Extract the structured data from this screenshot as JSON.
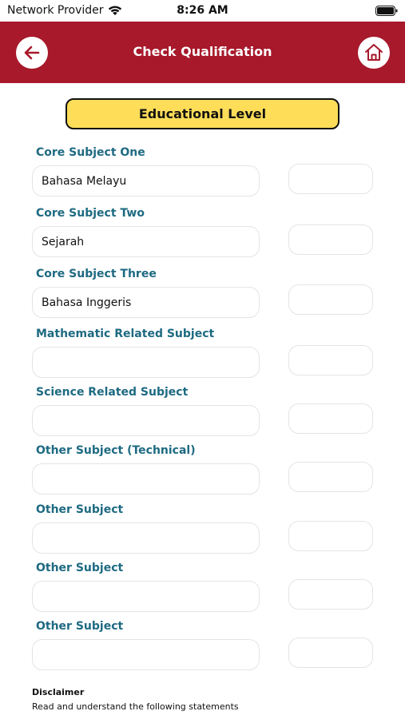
{
  "status_bar": {
    "carrier": "Network Provider",
    "time": "8:26 AM",
    "wifi_icon": "wifi-icon",
    "battery_icon": "battery-icon"
  },
  "header": {
    "title": "Check Qualification",
    "back_icon": "arrow-left-icon",
    "home_icon": "home-icon",
    "background": "#a7192b"
  },
  "educational_level": {
    "label": "Educational Level",
    "background": "#fedd59"
  },
  "fields": [
    {
      "label": "Core Subject One",
      "value": "Bahasa Melayu"
    },
    {
      "label": "Core Subject Two",
      "value": "Sejarah"
    },
    {
      "label": "Core Subject Three",
      "value": "Bahasa Inggeris"
    },
    {
      "label": "Mathematic Related Subject",
      "value": ""
    },
    {
      "label": "Science Related Subject",
      "value": ""
    },
    {
      "label": "Other Subject (Technical)",
      "value": ""
    },
    {
      "label": "Other Subject",
      "value": ""
    },
    {
      "label": "Other Subject",
      "value": ""
    },
    {
      "label": "Other Subject",
      "value": ""
    }
  ],
  "disclaimer": {
    "title": "Disclaimer",
    "text": "Read and understand the following statements"
  },
  "colors": {
    "label_color": "#1e6a82",
    "border": "#e4e4e4"
  }
}
